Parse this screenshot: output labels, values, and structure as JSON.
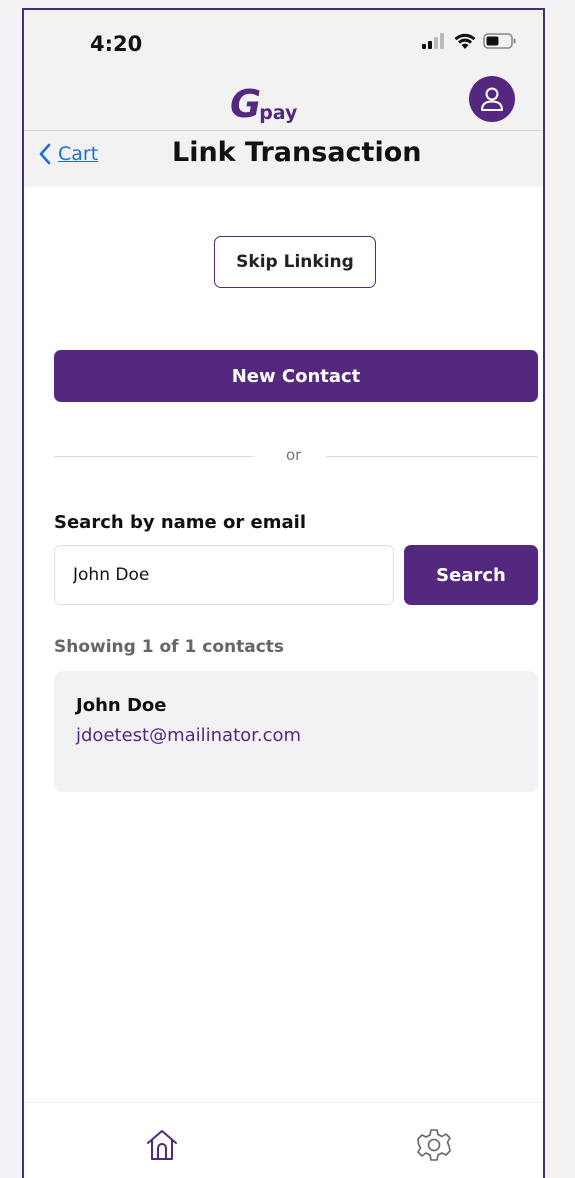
{
  "status_bar": {
    "time": "4:20"
  },
  "header": {
    "logo_mark": "G",
    "logo_text": "pay",
    "avatar_icon": "user-icon"
  },
  "nav": {
    "back_label": "Cart",
    "title": "Link Transaction"
  },
  "actions": {
    "skip_label": "Skip Linking",
    "new_contact_label": "New Contact",
    "divider_label": "or"
  },
  "search": {
    "label": "Search by name or email",
    "value": "John Doe",
    "button_label": "Search"
  },
  "results": {
    "count_text": "Showing 1 of 1 contacts",
    "contacts": [
      {
        "name": "John Doe",
        "email": "jdoetest@mailinator.com"
      }
    ]
  },
  "tab_bar": {
    "items": [
      {
        "icon": "home-icon"
      },
      {
        "icon": "gear-icon"
      }
    ]
  },
  "colors": {
    "brand": "#55287f",
    "link": "#1a6fd8",
    "header_bg": "#f2f2f2"
  }
}
